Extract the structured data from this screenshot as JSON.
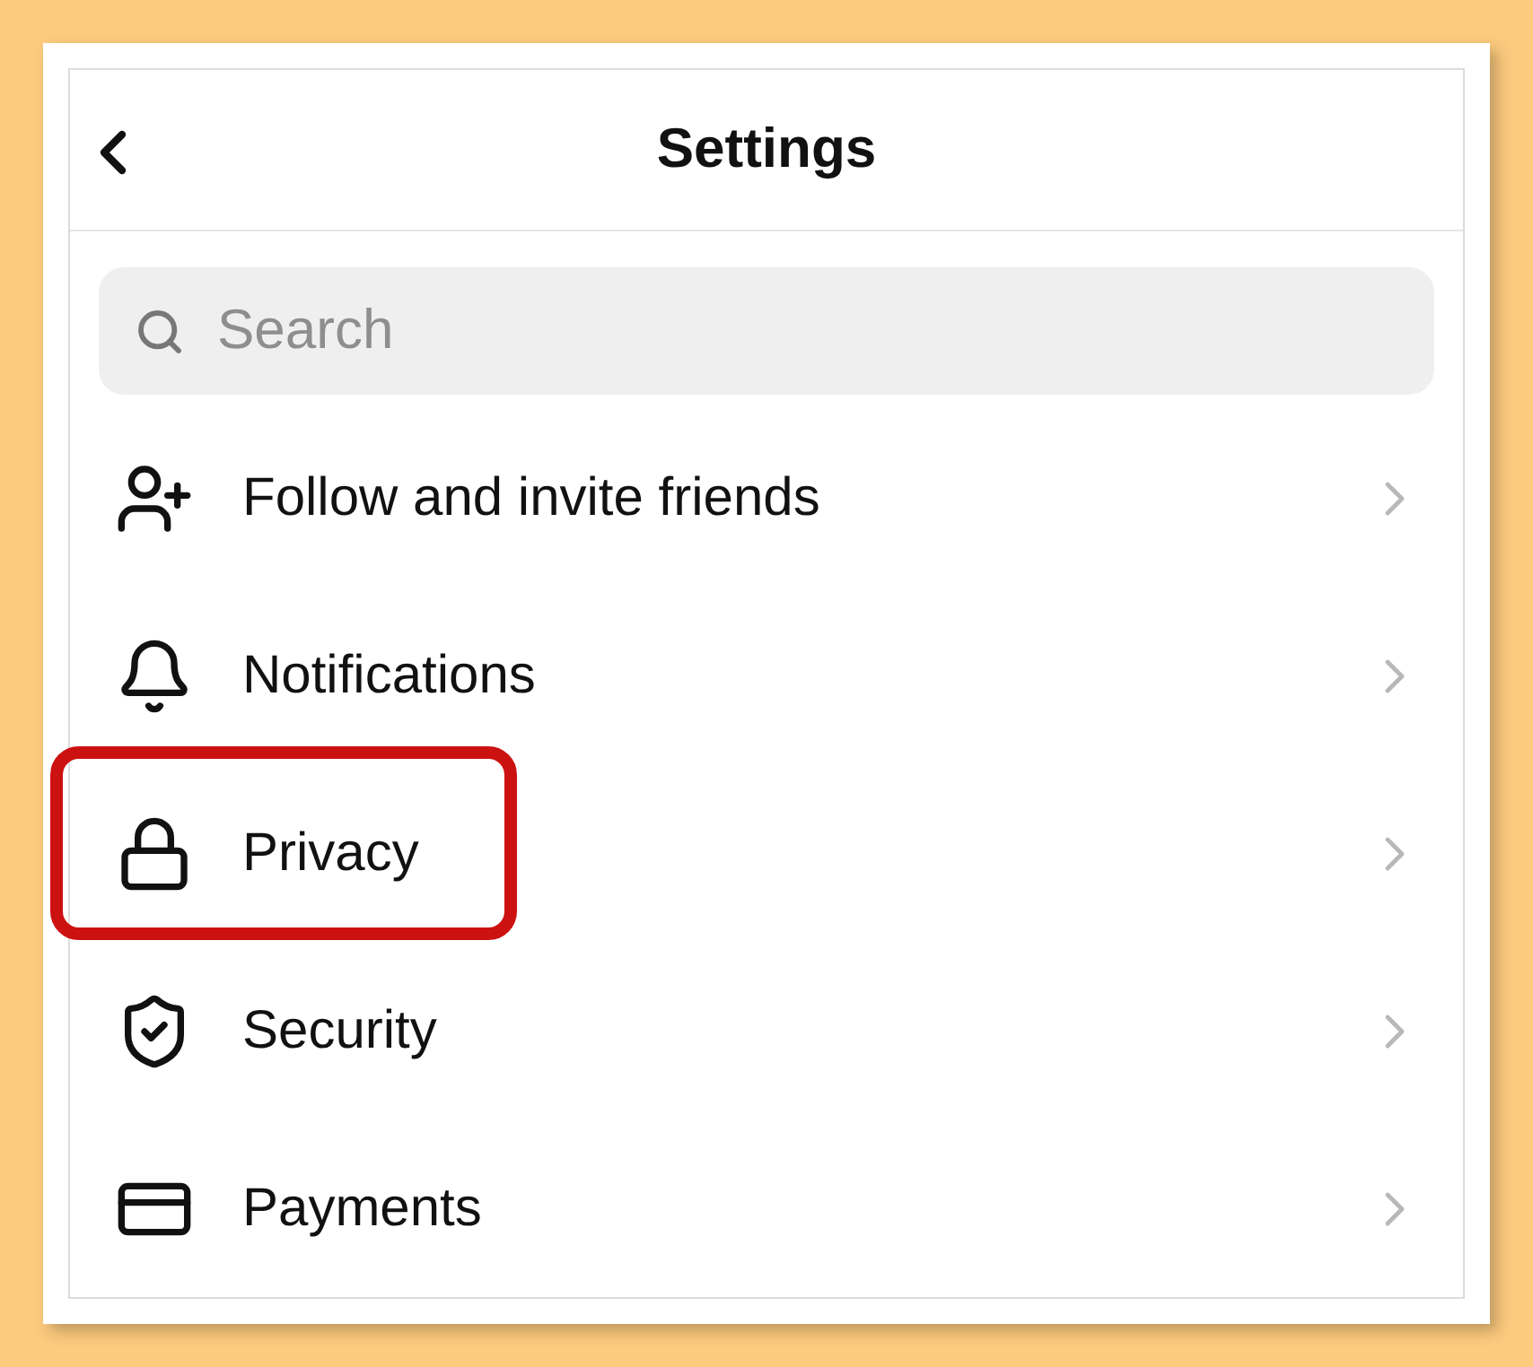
{
  "header": {
    "title": "Settings"
  },
  "search": {
    "placeholder": "Search"
  },
  "items": [
    {
      "kind": "add-person",
      "label": "Follow and invite friends",
      "highlighted": false
    },
    {
      "kind": "bell",
      "label": "Notifications",
      "highlighted": false
    },
    {
      "kind": "lock",
      "label": "Privacy",
      "highlighted": true
    },
    {
      "kind": "shield",
      "label": "Security",
      "highlighted": false
    },
    {
      "kind": "card",
      "label": "Payments",
      "highlighted": false
    }
  ]
}
